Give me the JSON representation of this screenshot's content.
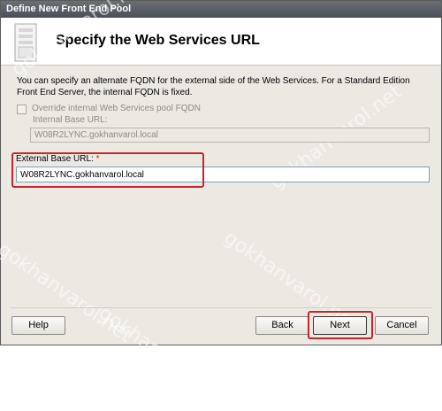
{
  "window": {
    "title": "Define New Front End Pool"
  },
  "header": {
    "title": "Specify the Web Services URL",
    "icon": "wizard-page-icon"
  },
  "description": "You can specify an alternate FQDN for the external side of the Web Services.  For a Standard Edition Front End Server, the internal FQDN is fixed.",
  "override": {
    "label": "Override internal Web Services pool FQDN",
    "checked": false,
    "enabled": false
  },
  "internal": {
    "label": "Internal Base URL:",
    "value": "W08R2LYNC.gokhanvarol.local"
  },
  "external": {
    "label": "External Base URL:",
    "required_marker": "*",
    "value": "W08R2LYNC.gokhanvarol.local"
  },
  "watermark": "gokhanvarol.net",
  "buttons": {
    "help": "Help",
    "back": "Back",
    "next": "Next",
    "cancel": "Cancel"
  },
  "colors": {
    "highlight": "#c8232e",
    "required": "#d11a1a"
  }
}
